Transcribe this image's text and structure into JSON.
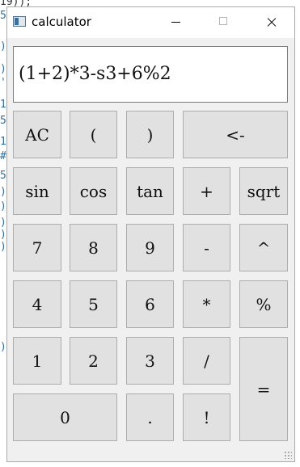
{
  "background_code": {
    "top_fragment": "19));",
    "line_markers": [
      "5",
      ")",
      ")",
      "'",
      "1",
      "5",
      "1",
      "#",
      "5",
      ")",
      ")",
      ")",
      ")",
      ")",
      ")"
    ]
  },
  "window": {
    "title": "calculator",
    "icon": "calculator-app-icon",
    "controls": [
      "minimize",
      "maximize",
      "close"
    ]
  },
  "display": {
    "expression": "(1+2)*3-s3+6%2"
  },
  "keys": {
    "ac": "AC",
    "lparen": "(",
    "rparen": ")",
    "backspace": "<-",
    "sin": "sin",
    "cos": "cos",
    "tan": "tan",
    "plus": "+",
    "sqrt": "sqrt",
    "d7": "7",
    "d8": "8",
    "d9": "9",
    "minus": "-",
    "power": "^",
    "d4": "4",
    "d5": "5",
    "d6": "6",
    "multiply": "*",
    "percent": "%",
    "d1": "1",
    "d2": "2",
    "d3": "3",
    "divide": "/",
    "equals": "=",
    "d0": "0",
    "dot": ".",
    "factorial": "!"
  }
}
